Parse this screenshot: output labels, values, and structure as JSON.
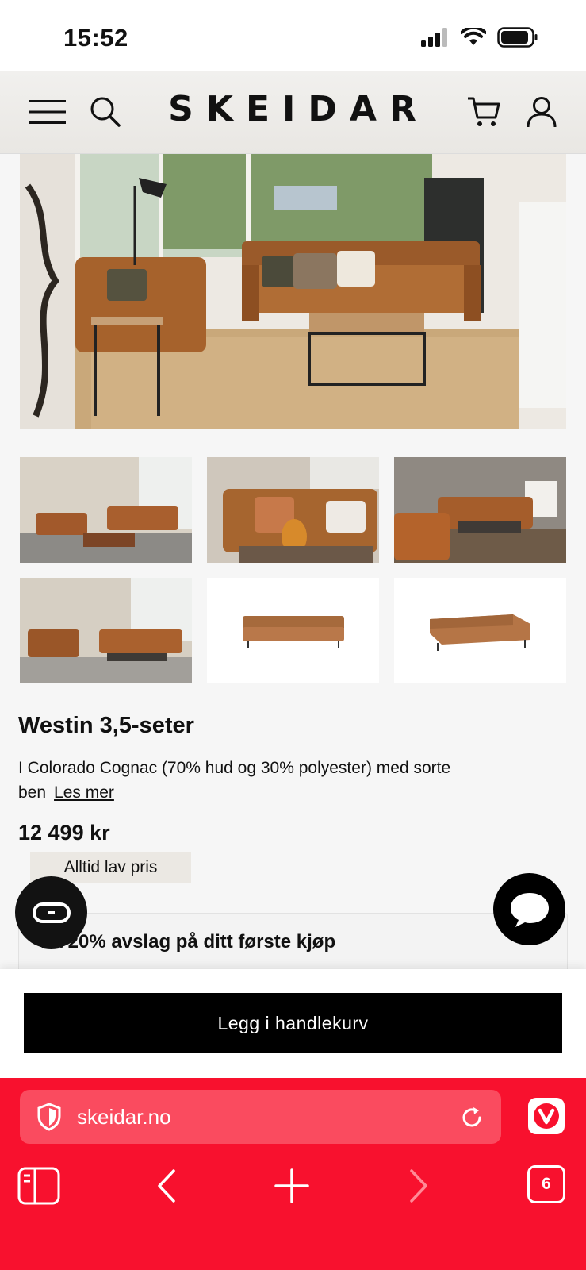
{
  "status_bar": {
    "time": "15:52"
  },
  "header": {
    "logo": "SKEIDAR"
  },
  "gallery": {
    "hero_alt": "Westin sofa living room",
    "thumbnails": [
      "thumb-1",
      "thumb-2",
      "thumb-3",
      "thumb-4",
      "thumb-5",
      "thumb-6"
    ]
  },
  "product": {
    "name": "Westin 3,5-seter",
    "description": "I Colorado Cognac (70% hud og 30% polyester) med sorte ben",
    "read_more": "Les mer",
    "price": "12 499 kr",
    "badge": "Alltid lav pris"
  },
  "promo": {
    "text": "Få 20% avslag på ditt første kjøp"
  },
  "cart": {
    "button_label": "Legg i handlekurv"
  },
  "browser": {
    "url": "skeidar.no",
    "tab_count": "6",
    "accent": "#f8112e"
  }
}
